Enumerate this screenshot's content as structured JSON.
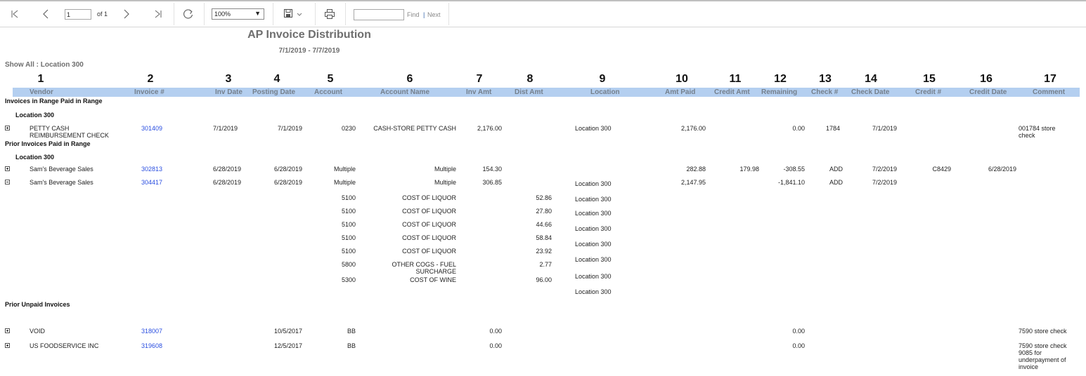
{
  "toolbar": {
    "page_value": "1",
    "of_pages": "of 1",
    "zoom": "100%",
    "find_label": "Find",
    "find_sep": "|",
    "next_label": "Next"
  },
  "report": {
    "title": "AP Invoice Distribution",
    "date_range": "7/1/2019 - 7/7/2019",
    "show_all": "Show All :   Location 300",
    "column_numbers": [
      "1",
      "2",
      "3",
      "4",
      "5",
      "6",
      "7",
      "8",
      "9",
      "10",
      "11",
      "12",
      "13",
      "14",
      "15",
      "16",
      "17"
    ],
    "headers": {
      "vendor": "Vendor",
      "invoice": "Invoice #",
      "inv_date": "Inv Date",
      "posting_date": "Posting Date",
      "account": "Account",
      "account_name": "Account Name",
      "inv_amt": "Inv Amt",
      "dist_amt": "Dist Amt",
      "location": "Location",
      "amt_paid": "Amt Paid",
      "credit_amt": "Credit Amt",
      "remaining": "Remaining",
      "check": "Check #",
      "check_date": "Check Date",
      "credit_no": "Credit #",
      "credit_date": "Credit Date",
      "comment": "Comment"
    },
    "section1": {
      "title": "Invoices in Range Paid in Range",
      "location": "Location 300",
      "row": {
        "vendor": "PETTY CASH REIMBURSEMENT CHECK",
        "invoice": "301409",
        "inv_date": "7/1/2019",
        "posting_date": "7/1/2019",
        "account": "0230",
        "account_name": "CASH-STORE PETTY CASH",
        "inv_amt": "2,176.00",
        "location": "Location 300",
        "amt_paid": "2,176.00",
        "remaining": "0.00",
        "check": "1784",
        "check_date": "7/1/2019",
        "comment": "001784 store check"
      }
    },
    "section2": {
      "title": "Prior Invoices Paid in Range",
      "location": "Location 300",
      "row1": {
        "vendor": "Sam's Beverage Sales",
        "invoice": "302813",
        "inv_date": "6/28/2019",
        "posting_date": "6/28/2019",
        "account": "Multiple",
        "account_name": "Multiple",
        "inv_amt": "154.30",
        "amt_paid": "282.88",
        "credit_amt": "179.98",
        "remaining": "-308.55",
        "check": "ADD",
        "check_date": "7/2/2019",
        "credit_no": "C8429",
        "credit_date": "6/28/2019"
      },
      "row2": {
        "vendor": "Sam's Beverage Sales",
        "invoice": "304417",
        "inv_date": "6/28/2019",
        "posting_date": "6/28/2019",
        "account": "Multiple",
        "account_name": "Multiple",
        "inv_amt": "306.85",
        "location": "Location 300",
        "amt_paid": "2,147.95",
        "remaining": "-1,841.10",
        "check": "ADD",
        "check_date": "7/2/2019"
      },
      "distributions": [
        {
          "account": "5100",
          "name": "COST OF LIQUOR",
          "amt": "52.86"
        },
        {
          "account": "5100",
          "name": "COST OF LIQUOR",
          "amt": "27.80"
        },
        {
          "account": "5100",
          "name": "COST OF LIQUOR",
          "amt": "44.66"
        },
        {
          "account": "5100",
          "name": "COST OF LIQUOR",
          "amt": "58.84"
        },
        {
          "account": "5100",
          "name": "COST OF LIQUOR",
          "amt": "23.92"
        },
        {
          "account": "5800",
          "name": "OTHER COGS - FUEL SURCHARGE",
          "amt": "2.77"
        },
        {
          "account": "5300",
          "name": "COST OF WINE",
          "amt": "96.00"
        }
      ],
      "dist_locations": [
        "Location 300",
        "Location 300",
        "Location 300",
        "Location 300",
        "Location 300",
        "Location 300",
        "Location 300"
      ]
    },
    "section3": {
      "title": "Prior Unpaid Invoices",
      "row1": {
        "vendor": "VOID",
        "invoice": "318007",
        "posting_date": "10/5/2017",
        "account": "BB",
        "inv_amt": "0.00",
        "remaining": "0.00",
        "comment": "7590  store check"
      },
      "row2": {
        "vendor": "US FOODSERVICE INC",
        "invoice": "319608",
        "posting_date": "12/5/2017",
        "account": "BB",
        "inv_amt": "0.00",
        "remaining": "0.00",
        "comment": "7590  store check 9085  for underpayment of invoice"
      }
    }
  }
}
